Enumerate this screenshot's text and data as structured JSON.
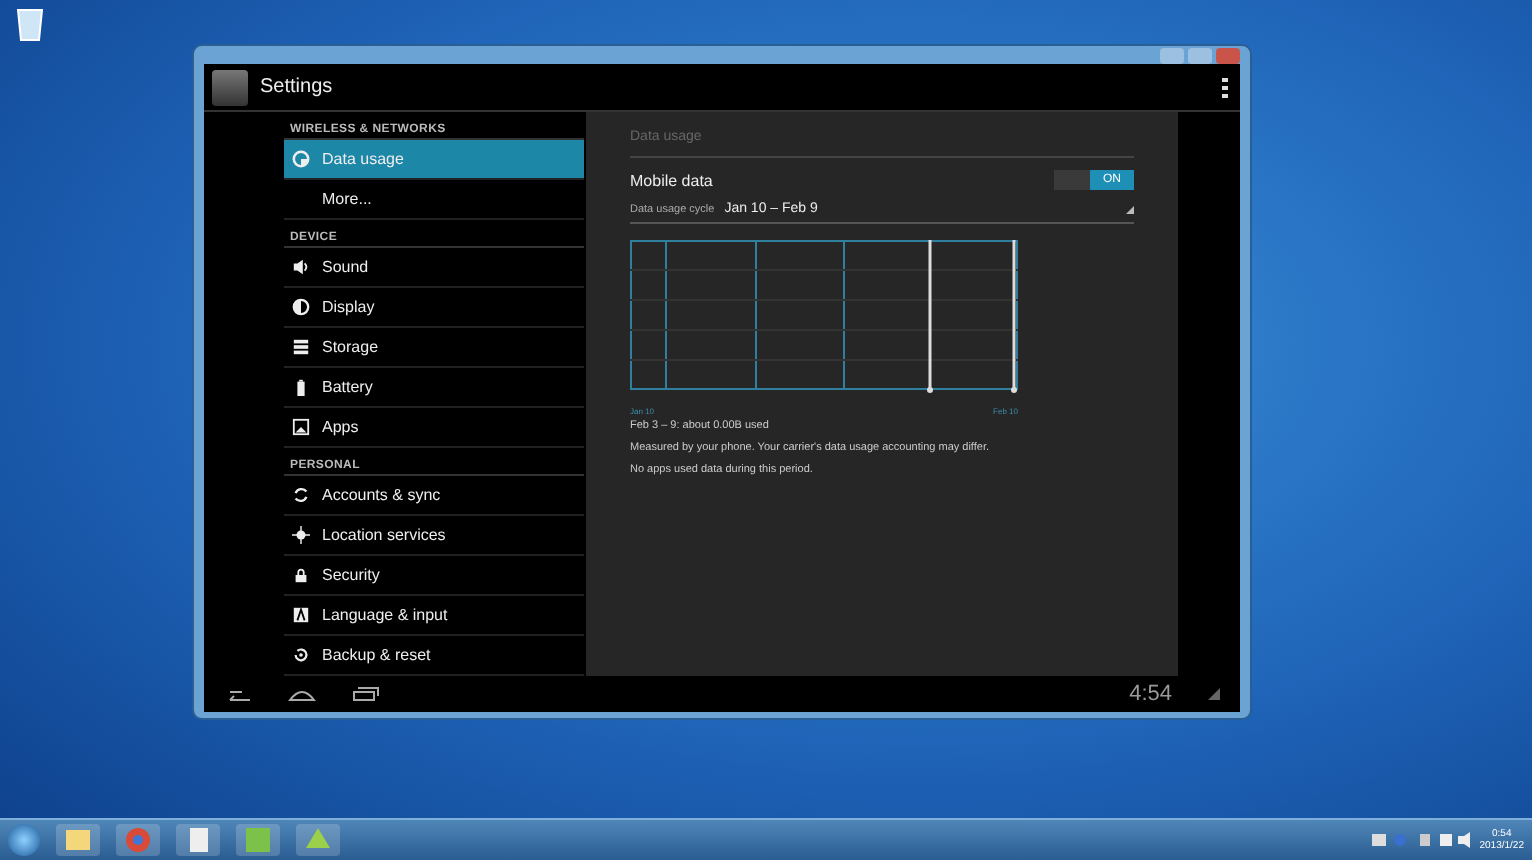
{
  "action_bar": {
    "title": "Settings"
  },
  "sidebar": {
    "sections": [
      {
        "header": "WIRELESS & NETWORKS",
        "items": [
          {
            "label": "Data usage",
            "selected": true
          },
          {
            "label": "More...",
            "selected": false
          }
        ]
      },
      {
        "header": "DEVICE",
        "items": [
          {
            "label": "Sound",
            "selected": false
          },
          {
            "label": "Display",
            "selected": false
          },
          {
            "label": "Storage",
            "selected": false
          },
          {
            "label": "Battery",
            "selected": false
          },
          {
            "label": "Apps",
            "selected": false
          }
        ]
      },
      {
        "header": "PERSONAL",
        "items": [
          {
            "label": "Accounts & sync",
            "selected": false
          },
          {
            "label": "Location services",
            "selected": false
          },
          {
            "label": "Security",
            "selected": false
          },
          {
            "label": "Language & input",
            "selected": false
          },
          {
            "label": "Backup & reset",
            "selected": false
          }
        ]
      }
    ]
  },
  "panel": {
    "title": "Data usage",
    "mobile_data": {
      "label": "Mobile data",
      "toggle_label": "ON",
      "on": true
    },
    "cycle": {
      "label": "Data usage cycle",
      "value": "Jan 10 – Feb 9"
    },
    "chart_labels": {
      "start": "Jan 10",
      "end": "Feb 10"
    },
    "notes": [
      "Feb 3 – 9: about 0.00B used",
      "Measured by your phone. Your carrier's data usage accounting may differ.",
      "No apps used data during this period."
    ]
  },
  "nav_bar": {
    "time": "4:54"
  },
  "taskbar": {
    "time": "0:54",
    "date": "2013/1/22"
  }
}
